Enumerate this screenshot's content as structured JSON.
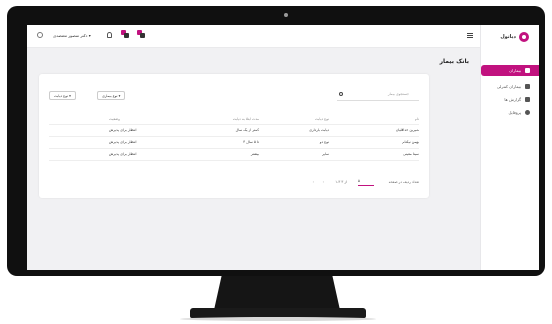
{
  "app": {
    "brand": "دیاتول",
    "accent": "#c1127f"
  },
  "sidebar": {
    "items": [
      {
        "label": "بیماران",
        "icon": "folder-icon",
        "active": true
      },
      {
        "label": "بیماران کنترلی",
        "icon": "close-icon",
        "active": false
      },
      {
        "label": "گزارش ها",
        "icon": "copy-icon",
        "active": false
      },
      {
        "label": "پروفایل",
        "icon": "user-icon",
        "active": false
      }
    ]
  },
  "topbar": {
    "user_label": "دکتر منصور معتضدی ▾"
  },
  "page": {
    "title": "بانک بیمار"
  },
  "search": {
    "placeholder": "جستجوی بیمار"
  },
  "filters": [
    {
      "label": "نوع بیماری ▾"
    },
    {
      "label": "نوع دیابت ▾"
    }
  ],
  "table": {
    "columns": [
      "نام",
      "نوع دیابت",
      "مدت ابتلا به دیابت",
      "وضعیت"
    ],
    "rows": [
      {
        "name": "شیرین خداقلیان",
        "type": "دیابت بارداری",
        "duration": "کمتر از یک سال",
        "status": "انتظار برای پذیرش"
      },
      {
        "name": "بهمن نیکنام",
        "type": "نوع دو",
        "duration": "۳ تا ۵ سال",
        "status": "انتظار برای پذیرش"
      },
      {
        "name": "سینا معینی",
        "type": "سایر",
        "duration": "بیشتر",
        "status": "انتظار برای پذیرش"
      }
    ]
  },
  "pagination": {
    "rows_label": "تعداد ردیف در صفحه",
    "rows_value": "۵",
    "range": "۱-۳ از ۳",
    "prev": "‹",
    "next": "›"
  }
}
